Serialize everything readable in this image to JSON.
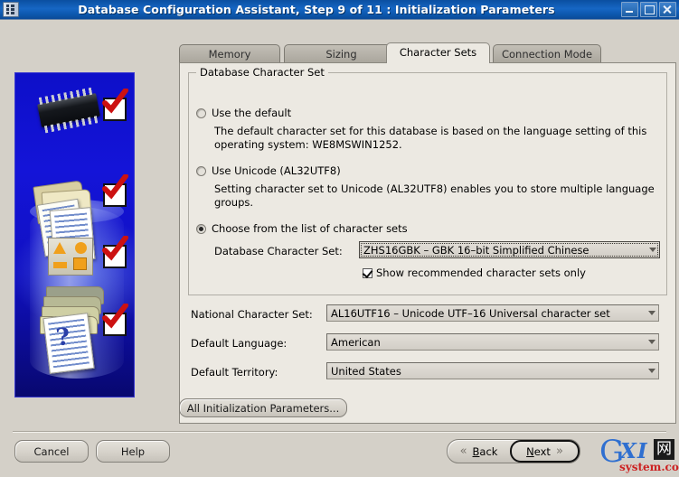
{
  "window": {
    "title": "Database Configuration Assistant, Step 9 of 11 : Initialization Parameters",
    "icon": "app-icon",
    "buttons": {
      "minimize": "–",
      "maximize": "□",
      "close": "✕"
    },
    "titlebar_color": "#1666c4"
  },
  "illustration": {
    "alt": "database-wizard-illustration",
    "background_color": "#1010c2",
    "items": [
      "memory-chip",
      "documents",
      "shapes-tile",
      "folders-question-doc"
    ],
    "check_mark_color": "#cc1111"
  },
  "tabs": [
    {
      "label": "Memory",
      "active": false
    },
    {
      "label": "Sizing",
      "active": false
    },
    {
      "label": "Character Sets",
      "active": true
    },
    {
      "label": "Connection Mode",
      "active": false
    }
  ],
  "group": {
    "title": "Database Character Set",
    "options": [
      {
        "id": "use-default",
        "label": "Use the default",
        "selected": false,
        "description": "The default character set for this database is based on the language setting of this operating system: WE8MSWIN1252."
      },
      {
        "id": "use-unicode",
        "label": "Use Unicode (AL32UTF8)",
        "selected": false,
        "description": "Setting character set to Unicode (AL32UTF8) enables you to store multiple language groups."
      },
      {
        "id": "choose-from-list",
        "label": "Choose from the list of character sets",
        "selected": true,
        "description": ""
      }
    ],
    "database_character_set": {
      "label": "Database Character Set:",
      "value": "ZHS16GBK – GBK 16–bit Simplified Chinese",
      "focused": true
    },
    "show_recommended": {
      "label": "Show recommended character sets only",
      "checked": true
    }
  },
  "fields": [
    {
      "label": "National Character Set:",
      "value": "AL16UTF16 – Unicode UTF–16 Universal character set"
    },
    {
      "label": "Default Language:",
      "value": "American"
    },
    {
      "label": "Default Territory:",
      "value": "United States"
    }
  ],
  "all_parameters_button": "All Initialization Parameters...",
  "footer": {
    "cancel": "Cancel",
    "help": "Help",
    "back": "Back",
    "back_mnemonic": "B",
    "next": "Next",
    "next_mnemonic": "N",
    "back_chevron": "«",
    "next_chevron": "»"
  },
  "watermark": {
    "g": "G",
    "xi": "XI",
    "wang": "网",
    "domain": "system.com",
    "blue": "#2f6fd0",
    "red": "#cc2222"
  }
}
